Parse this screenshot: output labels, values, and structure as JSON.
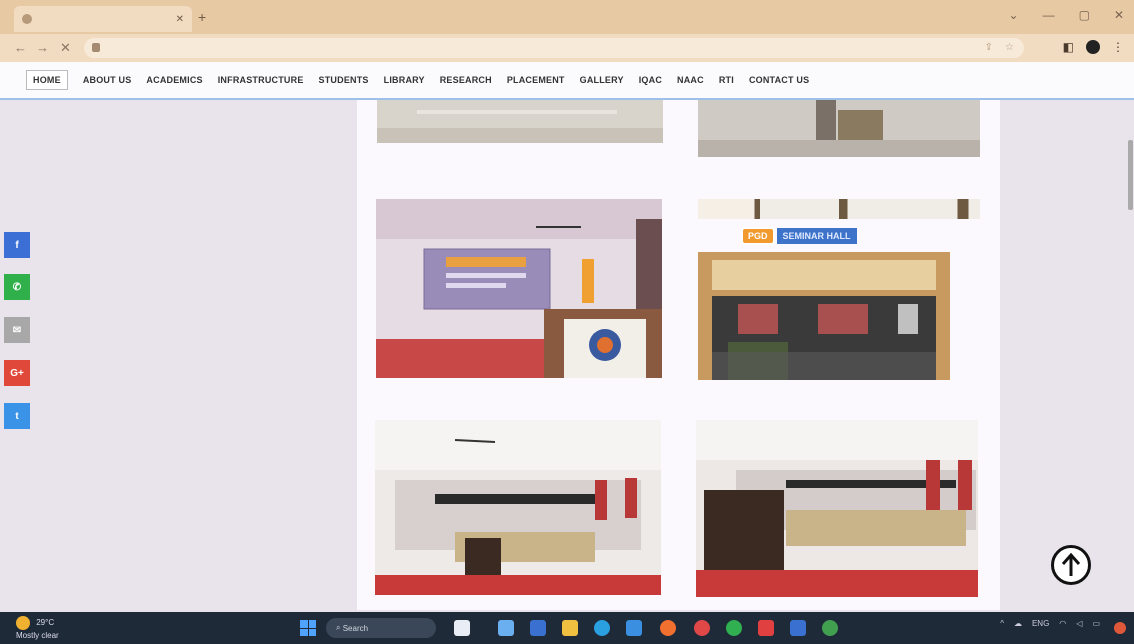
{
  "browser": {
    "tab_title": "",
    "url": "",
    "colors": {
      "tabbar": "#e7c9a4",
      "toolbar": "#f1dcc2"
    }
  },
  "nav": {
    "items": [
      {
        "label": "HOME",
        "active": true
      },
      {
        "label": "ABOUT US"
      },
      {
        "label": "ACADEMICS"
      },
      {
        "label": "INFRASTRUCTURE"
      },
      {
        "label": "STUDENTS"
      },
      {
        "label": "LIBRARY"
      },
      {
        "label": "RESEARCH"
      },
      {
        "label": "PLACEMENT"
      },
      {
        "label": "GALLERY"
      },
      {
        "label": "IQAC"
      },
      {
        "label": "NAAC"
      },
      {
        "label": "RTI"
      },
      {
        "label": "CONTACT US"
      }
    ]
  },
  "social": [
    {
      "icon": "facebook-icon",
      "glyph": "f",
      "color": "#3b6fd6"
    },
    {
      "icon": "whatsapp-icon",
      "glyph": "✆",
      "color": "#2fb04a"
    },
    {
      "icon": "email-icon",
      "glyph": "✉",
      "color": "#a8a8a8"
    },
    {
      "icon": "google-plus-icon",
      "glyph": "G+",
      "color": "#e0483a"
    },
    {
      "icon": "twitter-icon",
      "glyph": "t",
      "color": "#3a93e6"
    }
  ],
  "gallery": {
    "label_pgd": "PGD",
    "label_hall": "SEMINAR HALL"
  },
  "taskbar": {
    "weather_temp": "29°C",
    "weather_desc": "Mostly clear",
    "search_label": "Search",
    "lang": "ENG",
    "time": "",
    "date": ""
  }
}
